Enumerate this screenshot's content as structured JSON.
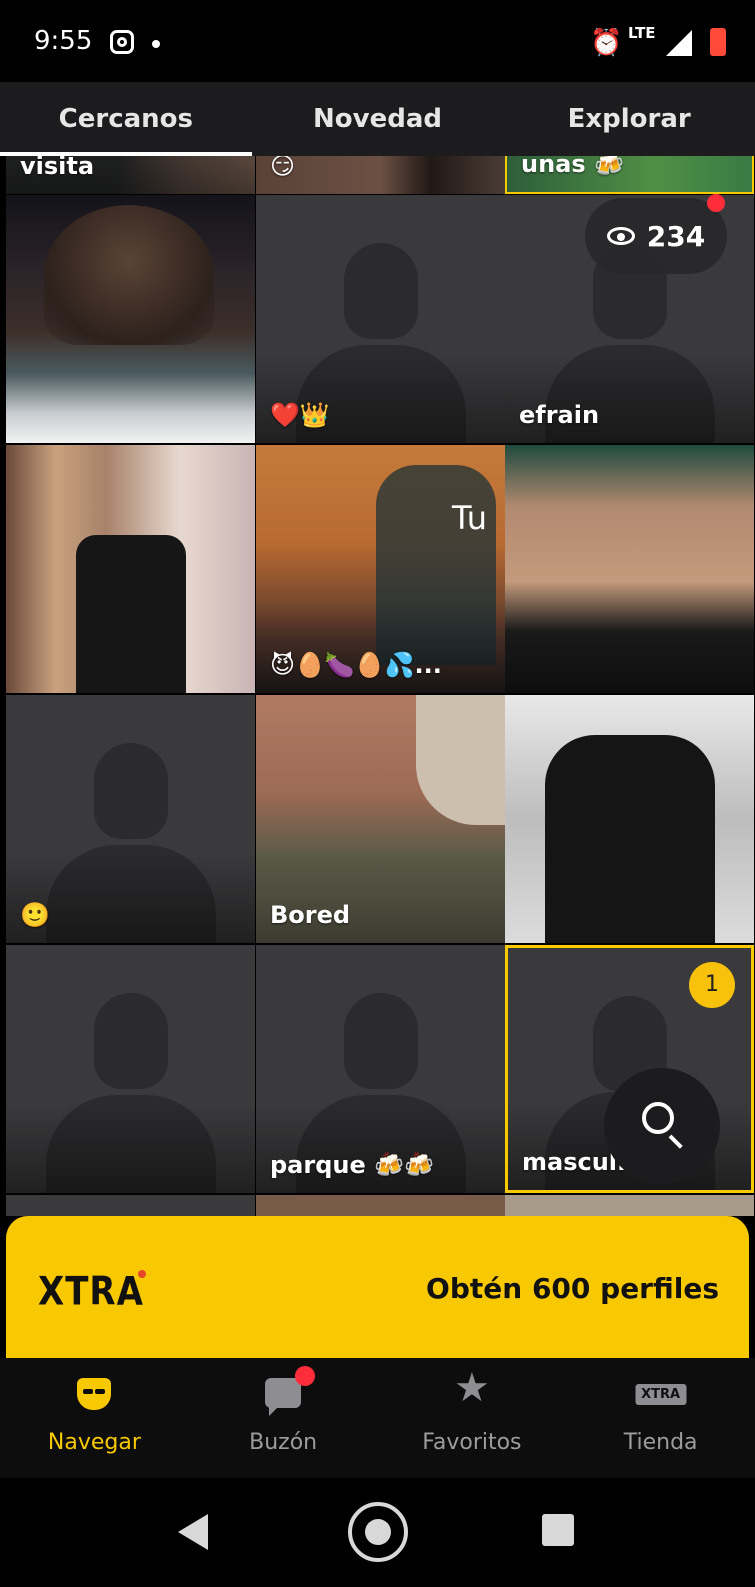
{
  "status_bar": {
    "time": "9:55",
    "network": "LTE",
    "alarm_glyph": "⏰"
  },
  "tabs": [
    {
      "label": "Cercanos",
      "active": true
    },
    {
      "label": "Novedad",
      "active": false
    },
    {
      "label": "Explorar",
      "active": false
    }
  ],
  "partial_top_row": [
    "visita",
    "😏",
    "unas 🍻"
  ],
  "grid": [
    {
      "label": "",
      "type": "photo-dark"
    },
    {
      "label": "❤️👑",
      "type": "placeholder"
    },
    {
      "label": "efrain",
      "type": "placeholder"
    },
    {
      "label": "",
      "type": "photo-mirror"
    },
    {
      "label": "😈🥚🍆🥚💦...",
      "type": "photo-orange",
      "overlay_text": "Tu"
    },
    {
      "label": "",
      "type": "photo-torso"
    },
    {
      "label": "🙂",
      "type": "placeholder"
    },
    {
      "label": "Bored",
      "type": "photo-face"
    },
    {
      "label": "",
      "type": "photo-bw"
    },
    {
      "label": "",
      "type": "placeholder"
    },
    {
      "label": "parque 🍻🍻",
      "type": "placeholder"
    },
    {
      "label": "mascul.",
      "type": "placeholder",
      "highlighted": true
    }
  ],
  "views_badge": {
    "count": "234"
  },
  "unread_badge": "1",
  "xtra_banner": {
    "logo": "XTRA",
    "cta": "Obtén 600 perfiles"
  },
  "bottom_nav": [
    {
      "label": "Navegar",
      "active": true
    },
    {
      "label": "Buzón",
      "active": false
    },
    {
      "label": "Favoritos",
      "active": false
    },
    {
      "label": "Tienda",
      "active": false,
      "icon_text": "XTRA"
    }
  ],
  "colors": {
    "accent": "#f8c800",
    "notification": "#ff2d3c",
    "placeholder_bg": "#3a3a3c"
  }
}
